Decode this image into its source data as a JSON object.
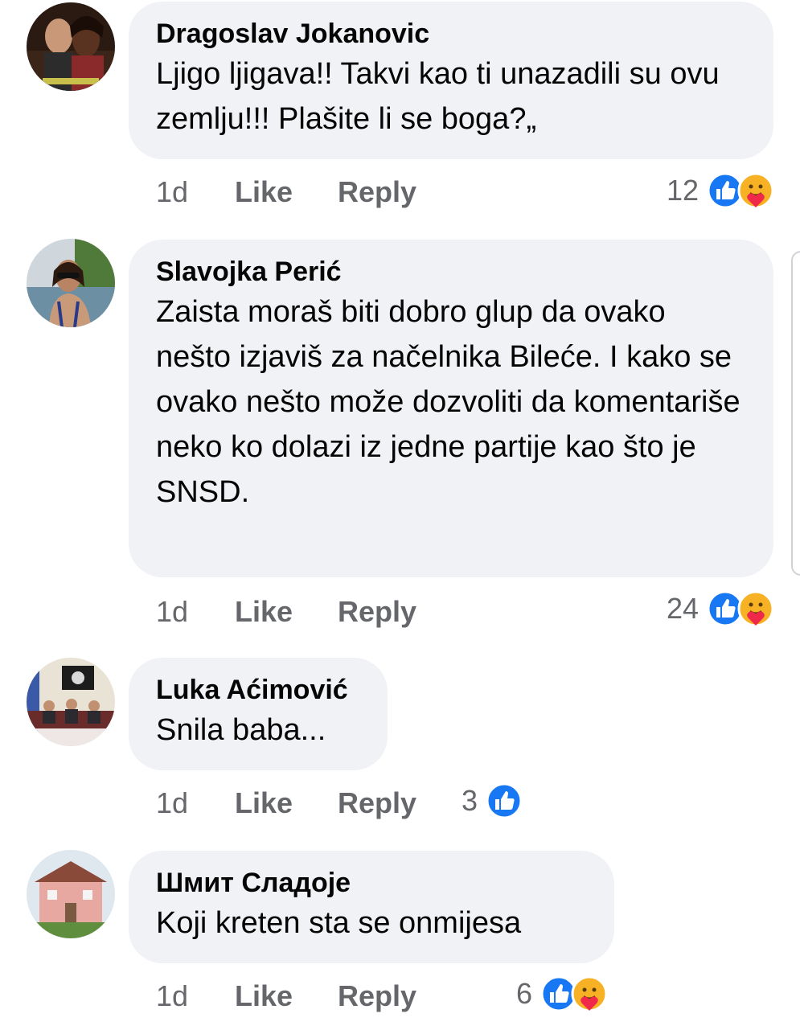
{
  "comments": [
    {
      "author": "Dragoslav Jokanovic",
      "text": "Ljigo ljigava!! Takvi kao ti unazadili su ovu zemlju!!! Plašite li se boga?„",
      "time": "1d",
      "like_label": "Like",
      "reply_label": "Reply",
      "reaction_count": "12",
      "reactions": [
        "like-icon",
        "care-icon"
      ]
    },
    {
      "author": "Slavojka Perić",
      "text": "Zaista moraš biti dobro glup da ovako nešto izjaviš za načelnika Bileće. I kako se ovako nešto može dozvoliti da komentariše neko ko dolazi iz jedne partije kao što je SNSD.",
      "time": "1d",
      "like_label": "Like",
      "reply_label": "Reply",
      "reaction_count": "24",
      "reactions": [
        "like-icon",
        "care-icon"
      ]
    },
    {
      "author": "Luka Aćimović",
      "text": "Snila baba...",
      "time": "1d",
      "like_label": "Like",
      "reply_label": "Reply",
      "reaction_count": "3",
      "reactions": [
        "like-icon"
      ]
    },
    {
      "author": "Шмит Сладоје",
      "text": "Koji kreten sta se onmijesa",
      "time": "1d",
      "like_label": "Like",
      "reply_label": "Reply",
      "reaction_count": "6",
      "reactions": [
        "like-icon",
        "care-icon"
      ]
    }
  ],
  "colors": {
    "bubble": "#f0f2f5",
    "secondary_text": "#65676b",
    "like_blue": "#1877f2",
    "care_yellow": "#f7b125"
  }
}
